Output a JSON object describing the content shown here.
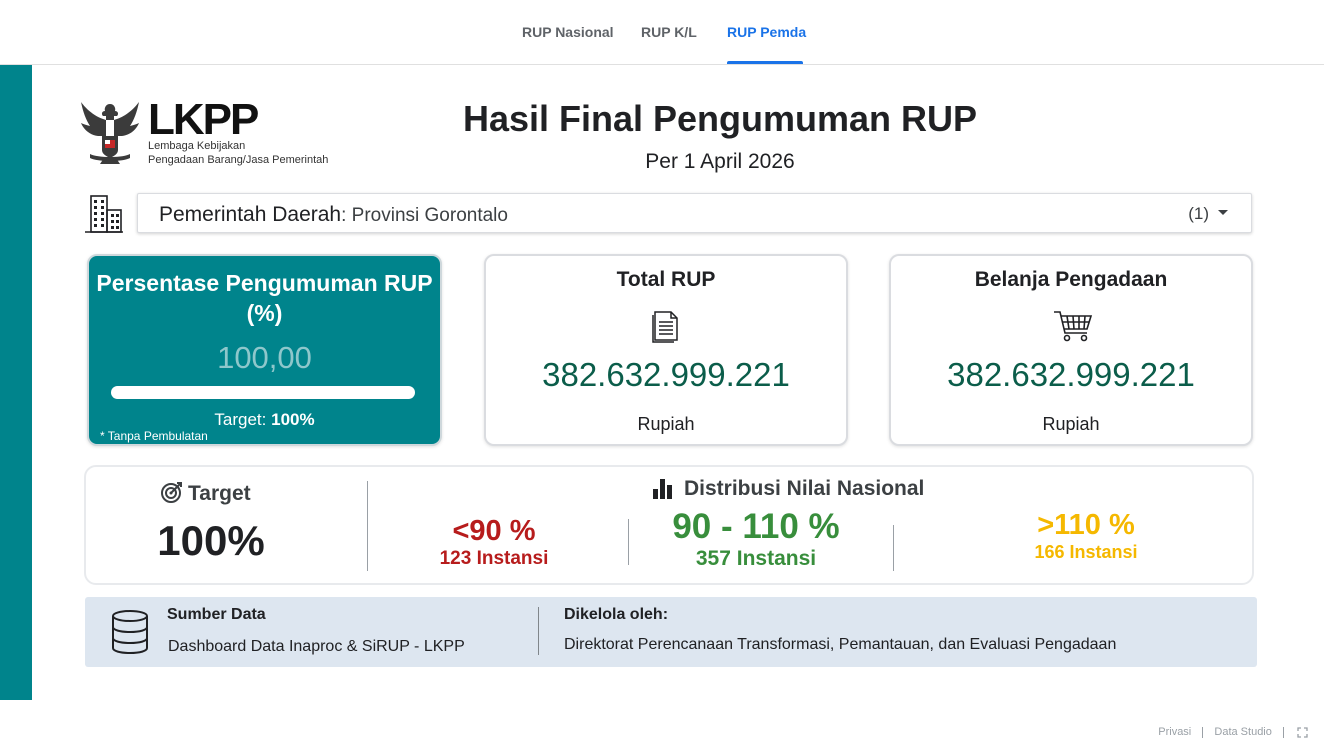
{
  "nav": {
    "tabs": [
      {
        "label": "RUP Nasional",
        "active": false
      },
      {
        "label": "RUP K/L",
        "active": false
      },
      {
        "label": "RUP Pemda",
        "active": true
      }
    ],
    "accent_color": "#1a73e8"
  },
  "brand": {
    "logo_text": "LKPP",
    "logo_subtitle_1": "Lembaga Kebijakan",
    "logo_subtitle_2": "Pengadaan Barang/Jasa Pemerintah",
    "primary_color": "#00848c"
  },
  "header": {
    "title": "Hasil Final Pengumuman RUP",
    "date": "Per 1 April 2026"
  },
  "filter": {
    "icon": "building-icon",
    "label": "Pemerintah Daerah",
    "value": ": Provinsi Gorontalo",
    "count": "(1)"
  },
  "kpi": {
    "percent_card": {
      "title": "Persentase Pengumuman RUP (%)",
      "value": "100,00",
      "progress": 1.0,
      "target_label": "Target: ",
      "target_value": "100%",
      "note": "* Tanpa Pembulatan"
    },
    "total_rup": {
      "title": "Total RUP",
      "icon": "document-icon",
      "value": "382.632.999.221",
      "unit": "Rupiah"
    },
    "belanja": {
      "title": "Belanja Pengadaan",
      "icon": "shopping-cart-icon",
      "value": "382.632.999.221",
      "unit": "Rupiah"
    },
    "value_color": "#0b5d4a"
  },
  "distribution": {
    "target_icon": "target-icon",
    "target_label": "Target",
    "target_value": "100%",
    "title_icon": "bar-chart-icon",
    "title": "Distribusi Nilai Nasional",
    "buckets": [
      {
        "label": "<90 %",
        "count": "123 Instansi",
        "color": "#b71c1c"
      },
      {
        "label": "90 - 110 %",
        "count": "357 Instansi",
        "color": "#388e3c"
      },
      {
        "label": ">110 %",
        "count": "166 Instansi",
        "color": "#f5b800"
      }
    ]
  },
  "footer": {
    "source_icon": "database-icon",
    "source_label": "Sumber Data",
    "source_value": "Dashboard Data Inaproc & SiRUP - LKPP",
    "manager_label": "Dikelola oleh:",
    "manager_value": "Direktorat Perencanaan Transformasi, Pemantauan, dan Evaluasi Pengadaan"
  },
  "bottom_links": {
    "privacy": "Privasi",
    "product": "Data Studio",
    "fullscreen_icon": "fullscreen-icon"
  }
}
